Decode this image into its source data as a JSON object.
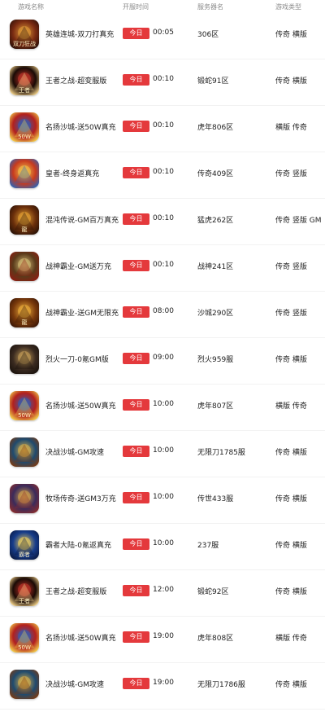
{
  "headers": {
    "game_name": "游戏名称",
    "open_time": "开服时间",
    "server_name": "服务器名",
    "game_type": "游戏类型"
  },
  "badge_label": "今日",
  "colors": {
    "badge": "#e4393c",
    "header_text": "#8a8a8a",
    "row_text": "#222222"
  },
  "rows": [
    {
      "name": "英雄连城-双刀打真充",
      "time": "00:05",
      "server": "306区",
      "type": "传奇 横版",
      "icon": "game-icon-dual-blade",
      "icon_text": "双刀狂战"
    },
    {
      "name": "王者之战-超变服版",
      "time": "00:10",
      "server": "锻蛇91区",
      "type": "传奇 横版",
      "icon": "game-icon-king-war",
      "icon_text": "王者"
    },
    {
      "name": "名扬沙城-送50W真充",
      "time": "00:10",
      "server": "虎年806区",
      "type": "横版 传奇",
      "icon": "game-icon-sand-city",
      "icon_text": "50W"
    },
    {
      "name": "皇者-终身返真充",
      "time": "00:10",
      "server": "传奇409区",
      "type": "传奇 竖版",
      "icon": "game-icon-emperor",
      "icon_text": ""
    },
    {
      "name": "混沌传说-GM百万真充",
      "time": "00:10",
      "server": "猛虎262区",
      "type": "传奇 竖版 GM",
      "icon": "game-icon-chaos-legend",
      "icon_text": "龍"
    },
    {
      "name": "战神霸业-GM送万充",
      "time": "00:10",
      "server": "战神241区",
      "type": "传奇 竖版",
      "icon": "game-icon-war-god",
      "icon_text": ""
    },
    {
      "name": "战神霸业-送GM无限充",
      "time": "08:00",
      "server": "沙城290区",
      "type": "传奇 竖版",
      "icon": "game-icon-war-god-gm",
      "icon_text": "龍"
    },
    {
      "name": "烈火一刀-0氪GM版",
      "time": "09:00",
      "server": "烈火959服",
      "type": "传奇 横版",
      "icon": "game-icon-flame-blade",
      "icon_text": ""
    },
    {
      "name": "名扬沙城-送50W真充",
      "time": "10:00",
      "server": "虎年807区",
      "type": "横版 传奇",
      "icon": "game-icon-sand-city",
      "icon_text": "50W"
    },
    {
      "name": "决战沙城-GM攻速",
      "time": "10:00",
      "server": "无限刀1785服",
      "type": "传奇 横版",
      "icon": "game-icon-decisive-sand",
      "icon_text": ""
    },
    {
      "name": "牧场传奇-送GM3万充",
      "time": "10:00",
      "server": "传世433服",
      "type": "传奇 横版",
      "icon": "game-icon-ranch-legend",
      "icon_text": ""
    },
    {
      "name": "霸者大陆-0氪返真充",
      "time": "10:00",
      "server": "237服",
      "type": "传奇 横版",
      "icon": "game-icon-overlord-land",
      "icon_text": "霸者"
    },
    {
      "name": "王者之战-超变服版",
      "time": "12:00",
      "server": "锻蛇92区",
      "type": "传奇 横版",
      "icon": "game-icon-king-war",
      "icon_text": "王者"
    },
    {
      "name": "名扬沙城-送50W真充",
      "time": "19:00",
      "server": "虎年808区",
      "type": "横版 传奇",
      "icon": "game-icon-sand-city",
      "icon_text": "50W"
    },
    {
      "name": "决战沙城-GM攻速",
      "time": "19:00",
      "server": "无限刀1786服",
      "type": "传奇 横版",
      "icon": "game-icon-decisive-sand",
      "icon_text": ""
    }
  ]
}
